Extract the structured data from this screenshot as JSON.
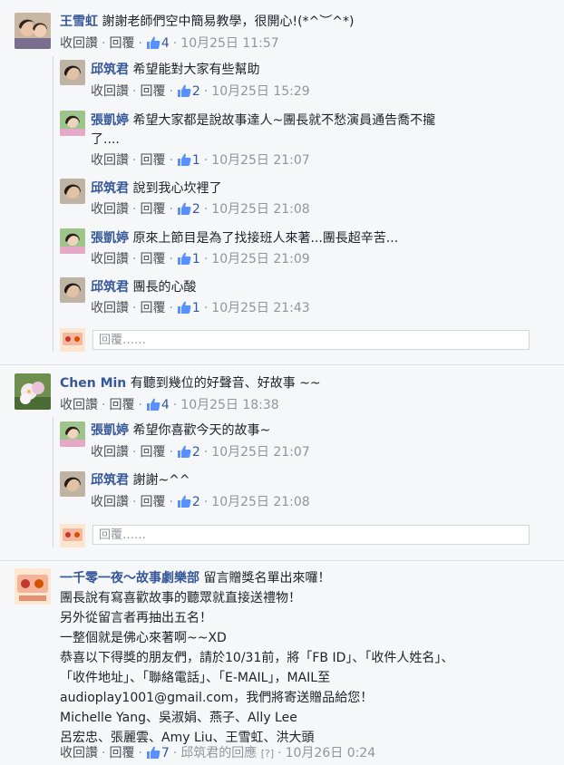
{
  "labels": {
    "unlike": "收回讚",
    "reply": "回覆",
    "sep": "·",
    "reply_placeholder": "回覆……",
    "reply_of": "邱筑君的回應",
    "help": "[?]"
  },
  "thread1": {
    "author": "王雪虹",
    "text": "謝謝老師們空中簡易教學，很開心!(*^︶^*)",
    "likes": "4",
    "time": "10月25日 11:57",
    "replies": [
      {
        "author": "邱筑君",
        "text": "希望能對大家有些幫助",
        "likes": "2",
        "time": "10月25日 15:29"
      },
      {
        "author": "張凱婷",
        "text": "希望大家都是說故事達人~團長就不愁演員通告喬不攏",
        "text2": "了....",
        "likes": "1",
        "time": "10月25日 21:07"
      },
      {
        "author": "邱筑君",
        "text": "說到我心坎裡了",
        "likes": "2",
        "time": "10月25日 21:08"
      },
      {
        "author": "張凱婷",
        "text": "原來上節目是為了找接班人來著...團長超辛苦...",
        "likes": "1",
        "time": "10月25日 21:09"
      },
      {
        "author": "邱筑君",
        "text": "團長的心酸",
        "likes": "1",
        "time": "10月25日 21:43"
      }
    ]
  },
  "thread2": {
    "author": "Chen Min",
    "text": "有聽到幾位的好聲音、好故事 ~~",
    "likes": "4",
    "time": "10月25日 18:38",
    "replies": [
      {
        "author": "張凱婷",
        "text": "希望你喜歡今天的故事~",
        "likes": "2",
        "time": "10月25日 21:07"
      },
      {
        "author": "邱筑君",
        "text": "謝謝~^^",
        "likes": "2",
        "time": "10月25日 21:08"
      }
    ]
  },
  "thread3": {
    "author": "一千零一夜～故事劇樂部",
    "lines": [
      "留言贈獎名單出來囉！",
      "團長說有寫喜歡故事的聽眾就直接送禮物！",
      "另外從留言者再抽出五名！",
      "一整個就是佛心來著啊~~XD",
      "恭喜以下得獎的朋友們，請於10/31前，將「FB ID」、「收件人姓名」、",
      "「收件地址」、「聯絡電話」、「E-MAIL」，MAIL至",
      "audioplay1001@gmail.com，我們將寄送贈品給您！",
      "Michelle Yang、吳淑娟、燕子、Ally Lee",
      "呂宏忠、張麗雲、Amy Liu、王雪虹、洪大頭"
    ],
    "likes": "7",
    "time": "10月26日 0:24"
  },
  "colors": {
    "link": "#365899",
    "meta": "#90949c",
    "action": "#4b4f56",
    "background": "#f6f7f9"
  },
  "icons": {
    "like": "thumbs-up-icon"
  }
}
